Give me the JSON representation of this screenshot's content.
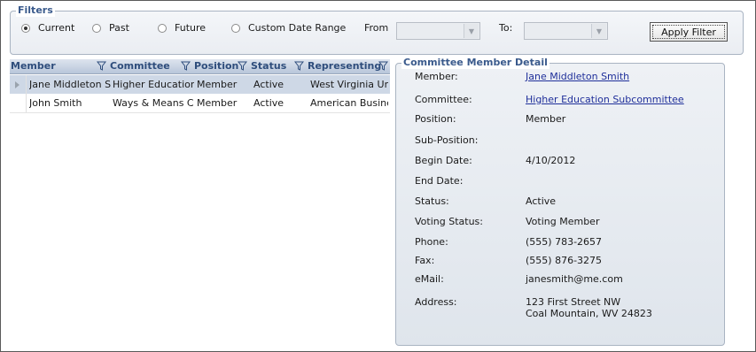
{
  "filters": {
    "legend": "Filters",
    "options": [
      "Current",
      "Past",
      "Future",
      "Custom Date Range"
    ],
    "selected": "Current",
    "from_label": "From",
    "from_value": "",
    "to_label": "To:",
    "to_value": "",
    "apply_label": "Apply Filter"
  },
  "grid": {
    "columns": [
      "Member",
      "Committee",
      "Position",
      "Status",
      "Representing"
    ],
    "rows": [
      {
        "member": "Jane Middleton S",
        "committee": "Higher Education",
        "position": "Member",
        "status": "Active",
        "representing": "West Virginia Uni",
        "selected": true
      },
      {
        "member": "John Smith",
        "committee": "Ways & Means C",
        "position": "Member",
        "status": "Active",
        "representing": "American Busines",
        "selected": false
      }
    ]
  },
  "detail": {
    "legend": "Committee Member Detail",
    "member_label": "Member:",
    "member_value": "Jane Middleton Smith",
    "committee_label": "Committee:",
    "committee_value": "Higher Education Subcommittee",
    "position_label": "Position:",
    "position_value": "Member",
    "subposition_label": "Sub-Position:",
    "subposition_value": "",
    "begin_label": "Begin Date:",
    "begin_value": "4/10/2012",
    "end_label": "End Date:",
    "end_value": "",
    "status_label": "Status:",
    "status_value": "Active",
    "voting_label": "Voting Status:",
    "voting_value": "Voting Member",
    "phone_label": "Phone:",
    "phone_value": "(555) 783-2657",
    "fax_label": "Fax:",
    "fax_value": "(555) 876-3275",
    "email_label": "eMail:",
    "email_value": "janesmith@me.com",
    "address_label": "Address:",
    "address_line1": "123 First Street NW",
    "address_line2": "Coal Mountain, WV 24823"
  },
  "icons": {
    "filter": "funnel-icon",
    "dropdown": "chevron-down-icon",
    "row_indicator": "triangle-right-icon"
  },
  "colors": {
    "header_text": "#2e4d7c",
    "link": "#1f2f9a",
    "selected_row": "#ced8e6"
  }
}
